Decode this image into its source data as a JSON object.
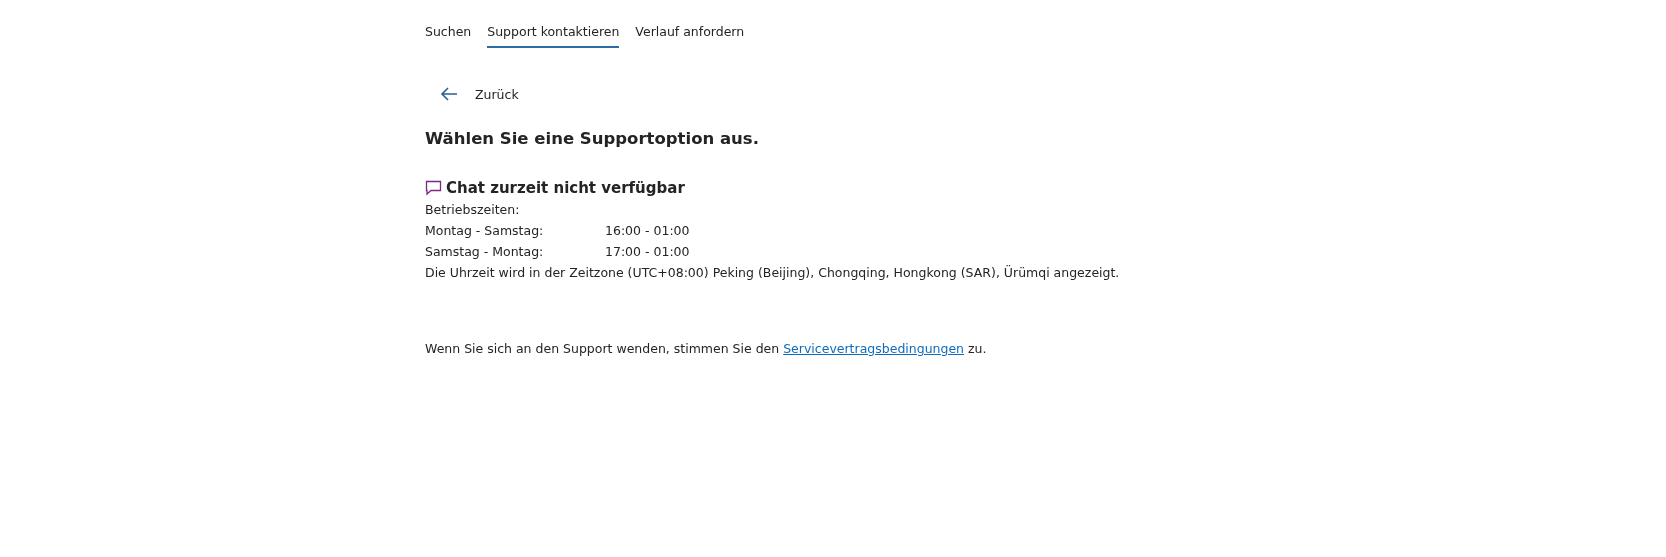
{
  "tabs": [
    {
      "label": "Suchen",
      "selected": false
    },
    {
      "label": "Support kontaktieren",
      "selected": true
    },
    {
      "label": "Verlauf anfordern",
      "selected": false
    }
  ],
  "back": {
    "label": "Zurück"
  },
  "heading": "Wählen Sie eine Supportoption aus.",
  "chat": {
    "title": "Chat zurzeit nicht verfügbar",
    "hours_label": "Betriebszeiten:",
    "hours": [
      {
        "days": "Montag - Samstag:",
        "time": "16:00 - 01:00"
      },
      {
        "days": "Samstag - Montag:",
        "time": "17:00 - 01:00"
      }
    ],
    "timezone_note": "Die Uhrzeit wird in der Zeitzone (UTC+08:00) Peking (Beijing), Chongqing, Hongkong (SAR), Ürümqi angezeigt."
  },
  "footer": {
    "before": "Wenn Sie sich an den Support wenden, stimmen Sie den ",
    "link": "Servicevertragsbedingungen",
    "after": " zu."
  }
}
